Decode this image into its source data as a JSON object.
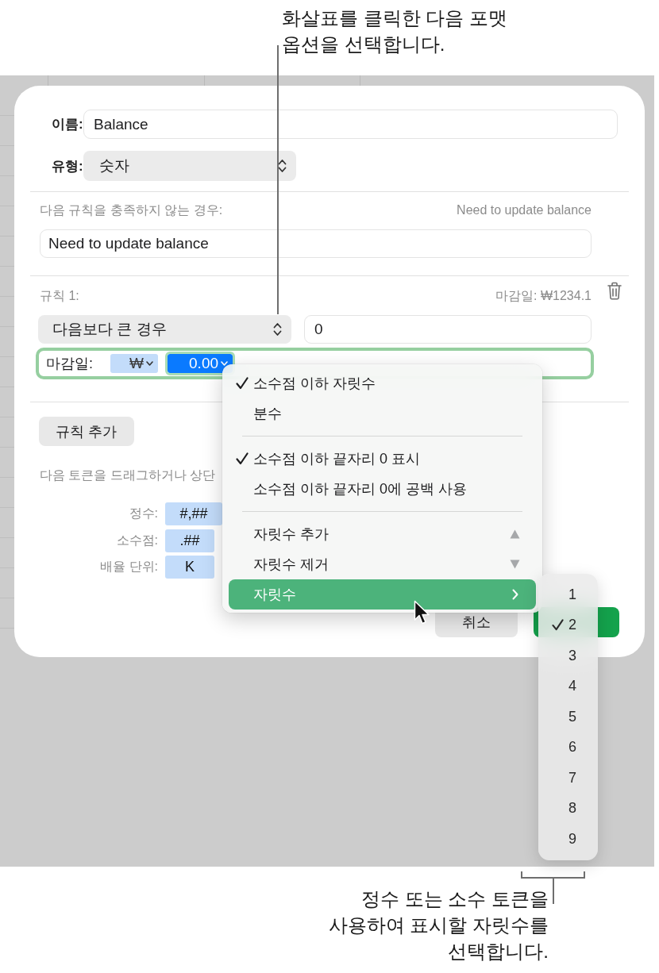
{
  "top_callout": {
    "lines": [
      "화살표를 클릭한 다음 포맷",
      "옵션을 선택합니다."
    ]
  },
  "dialog": {
    "name_field": {
      "label": "이름:",
      "value": "Balance"
    },
    "type_field": {
      "label": "유형:",
      "value": "숫자"
    },
    "failure": {
      "label": "다음 규칙을 충족하지 않는 경우:",
      "preview": "Need to update balance",
      "value": "Need to update balance"
    },
    "rules": [
      {
        "label": "규칙 1:",
        "preview": "마감일: ₩1234.1",
        "condition": "다음보다 큰 경우",
        "value": "0",
        "format": {
          "label": "마감일:",
          "tokens": [
            {
              "text": "₩",
              "selected": false
            },
            {
              "text": "0.00",
              "selected": true
            }
          ]
        }
      }
    ],
    "add_rule_button": "규칙 추가",
    "token_hint": "다음 토큰을 드래그하거나 상단",
    "token_rows": [
      {
        "label": "정수:",
        "token": "#,##"
      },
      {
        "label": "소수점:",
        "token": ".##"
      },
      {
        "label": "배율 단위:",
        "token": "K"
      }
    ],
    "buttons": [
      {
        "kind": "cancel",
        "label": "취소"
      },
      {
        "kind": "default"
      }
    ]
  },
  "menu": {
    "items": [
      {
        "kind": "option",
        "label": "소수점 이하 자릿수",
        "checked": true,
        "selected": false
      },
      {
        "kind": "option",
        "label": "분수",
        "checked": false,
        "selected": false
      },
      {
        "kind": "separator"
      },
      {
        "kind": "option",
        "label": "소수점 이하 끝자리 0 표시",
        "checked": true,
        "selected": false
      },
      {
        "kind": "option",
        "label": "소수점 이하 끝자리 0에 공백 사용",
        "checked": false,
        "selected": false
      },
      {
        "kind": "separator"
      },
      {
        "kind": "increase",
        "label": "자릿수 추가",
        "selected": false
      },
      {
        "kind": "decrease",
        "label": "자릿수 제거",
        "selected": false
      },
      {
        "kind": "submenu",
        "label": "자릿수",
        "selected": true
      }
    ]
  },
  "submenu": {
    "items": [
      {
        "label": "1",
        "checked": false
      },
      {
        "label": "2",
        "checked": true
      },
      {
        "label": "3",
        "checked": false
      },
      {
        "label": "4",
        "checked": false
      },
      {
        "label": "5",
        "checked": false
      },
      {
        "label": "6",
        "checked": false
      },
      {
        "label": "7",
        "checked": false
      },
      {
        "label": "8",
        "checked": false
      },
      {
        "label": "9",
        "checked": false
      }
    ]
  },
  "bottom_callout": {
    "lines": [
      "정수 또는 소수 토큰을",
      "사용하여 표시할 자릿수를",
      "선택합니다."
    ]
  }
}
